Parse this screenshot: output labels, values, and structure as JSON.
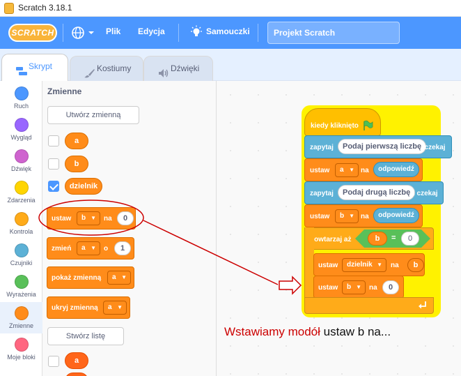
{
  "window": {
    "title": "Scratch 3.18.1"
  },
  "menubar": {
    "logo": "SCRATCH",
    "file": "Plik",
    "edit": "Edycja",
    "tutorials": "Samouczki",
    "project_title": "Projekt Scratch"
  },
  "tabs": [
    {
      "label": "Skrypt",
      "active": true
    },
    {
      "label": "Kostiumy",
      "active": false
    },
    {
      "label": "Dźwięki",
      "active": false
    }
  ],
  "categories": [
    {
      "label": "Ruch",
      "color": "#4c97ff"
    },
    {
      "label": "Wygląd",
      "color": "#9966ff"
    },
    {
      "label": "Dźwięk",
      "color": "#cf63cf"
    },
    {
      "label": "Zdarzenia",
      "color": "#ffd500"
    },
    {
      "label": "Kontrola",
      "color": "#ffab19"
    },
    {
      "label": "Czujniki",
      "color": "#5cb1d6"
    },
    {
      "label": "Wyrażenia",
      "color": "#59c059"
    },
    {
      "label": "Zmienne",
      "color": "#ff8c1a",
      "selected": true
    },
    {
      "label": "Moje bloki",
      "color": "#ff6680"
    }
  ],
  "palette": {
    "title": "Zmienne",
    "make_variable": "Utwórz zmienną",
    "variables": [
      {
        "name": "a",
        "checked": false
      },
      {
        "name": "b",
        "checked": false
      },
      {
        "name": "dzielnik",
        "checked": true
      }
    ],
    "set_block": {
      "label": "ustaw",
      "var": "b",
      "to": "na",
      "value": "0"
    },
    "change_block": {
      "label": "zmień",
      "var": "a",
      "by": "o",
      "value": "1"
    },
    "show_block": {
      "label": "pokaż zmienną",
      "var": "a"
    },
    "hide_block": {
      "label": "ukryj zmienną",
      "var": "a"
    },
    "make_list": "Stwórz listę",
    "list_item": "a"
  },
  "script": {
    "hat": "kiedy kliknięto",
    "ask1": {
      "label": "zapytaj",
      "text": "Podaj pierwszą liczbę",
      "wait": "i czekaj"
    },
    "set1": {
      "label": "ustaw",
      "var": "a",
      "to": "na",
      "value": "odpowiedź"
    },
    "ask2": {
      "label": "zapytaj",
      "text": "Podaj drugą liczbę",
      "wait": "i czekaj"
    },
    "set2": {
      "label": "ustaw",
      "var": "b",
      "to": "na",
      "value": "odpowiedź"
    },
    "repeat": {
      "label": "powtarzaj aż",
      "left": "b",
      "op": "=",
      "right": "0"
    },
    "inner1": {
      "label": "ustaw",
      "var": "dzielnik",
      "to": "na",
      "value": "b"
    },
    "inner2": {
      "label": "ustaw",
      "var": "b",
      "to": "na",
      "value": "0"
    }
  },
  "annotation": {
    "red_text": "Wstawiamy modół",
    "black_text": "ustaw b na...",
    "color": "#cc0000"
  }
}
